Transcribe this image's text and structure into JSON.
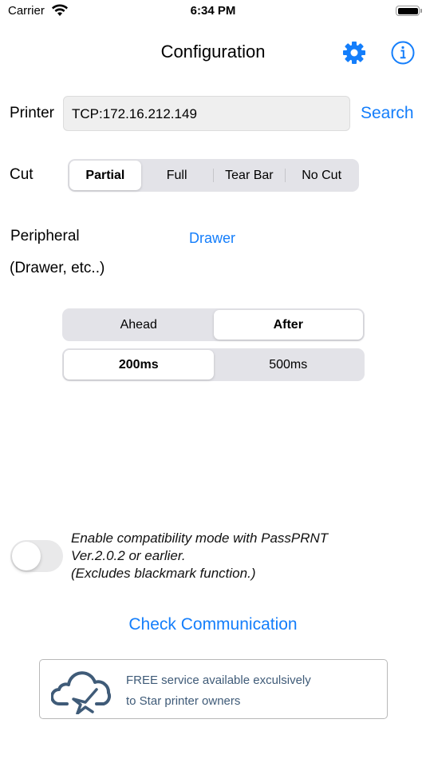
{
  "status_bar": {
    "carrier": "Carrier",
    "time": "6:34 PM",
    "battery_level": 1.0
  },
  "nav": {
    "title": "Configuration",
    "icons": [
      "gear-icon",
      "info-icon"
    ],
    "accent_color": "#147efb"
  },
  "printer": {
    "label": "Printer",
    "value": "TCP:172.16.212.149",
    "search_label": "Search"
  },
  "cut": {
    "label": "Cut",
    "options": [
      "Partial",
      "Full",
      "Tear Bar",
      "No Cut"
    ],
    "selected": "Partial"
  },
  "peripheral": {
    "label": "Peripheral",
    "sublabel": "(Drawer, etc..)",
    "link_label": "Drawer",
    "timing": {
      "options": [
        "Ahead",
        "After"
      ],
      "selected": "After"
    },
    "duration": {
      "options": [
        "200ms",
        "500ms"
      ],
      "selected": "200ms"
    }
  },
  "compatibility": {
    "enabled": false,
    "lines": [
      "Enable compatibility mode with PassPRNT",
      "Ver.2.0.2 or earlier.",
      "(Excludes blackmark function.)"
    ]
  },
  "check_communication_label": "Check Communication",
  "banner": {
    "icon": "cloud-star-icon",
    "lines": [
      "FREE service available exculsively",
      "to Star printer owners"
    ]
  }
}
